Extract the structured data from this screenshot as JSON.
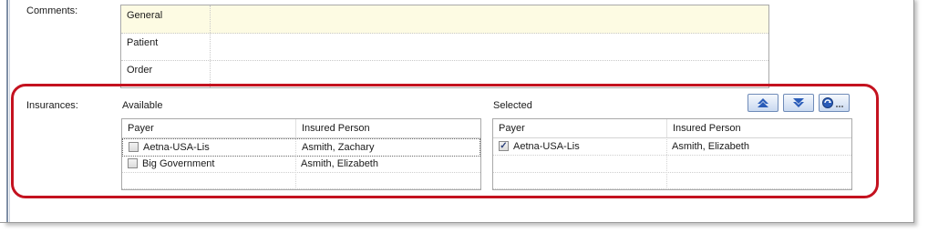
{
  "comments": {
    "label": "Comments:",
    "rows": [
      {
        "label": "General"
      },
      {
        "label": "Patient"
      },
      {
        "label": "Order"
      }
    ]
  },
  "insurances": {
    "label": "Insurances:",
    "available": {
      "title": "Available",
      "columns": [
        "Payer",
        "Insured Person"
      ],
      "rows": [
        {
          "payer": "Aetna-USA-Lis",
          "insured": "Asmith, Zachary",
          "checked": false
        },
        {
          "payer": "Big Government",
          "insured": "Asmith, Elizabeth",
          "checked": false
        }
      ]
    },
    "selected": {
      "title": "Selected",
      "columns": [
        "Payer",
        "Insured Person"
      ],
      "rows": [
        {
          "payer": "Aetna-USA-Lis",
          "insured": "Asmith, Elizabeth",
          "checked": true
        }
      ]
    },
    "toolbar": {
      "more_label": "..."
    }
  },
  "colors": {
    "highlight": "#c4121f",
    "button_border": "#6f8bb8",
    "arrow": "#2a5cb8",
    "active_row": "#fdfbe3"
  },
  "icons": [
    "move-up-icon",
    "move-down-icon",
    "insurance-browse-icon",
    "checkbox-checked-icon"
  ]
}
